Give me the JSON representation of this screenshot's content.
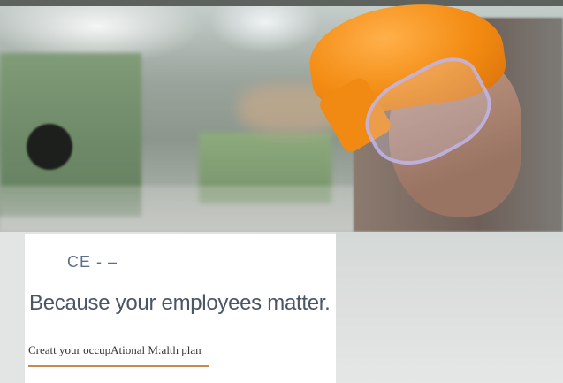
{
  "logo": {
    "text": "CE - –"
  },
  "headline": "Because your employees matter.",
  "cta": {
    "label": "Creatt your occupAtional M:alth plan"
  },
  "colors": {
    "accent_rule": "#c98a4f",
    "headline_text": "#4a5566",
    "logo_text": "#5a6f8c"
  },
  "hero": {
    "image": "worker-in-hard-hat-photo"
  }
}
